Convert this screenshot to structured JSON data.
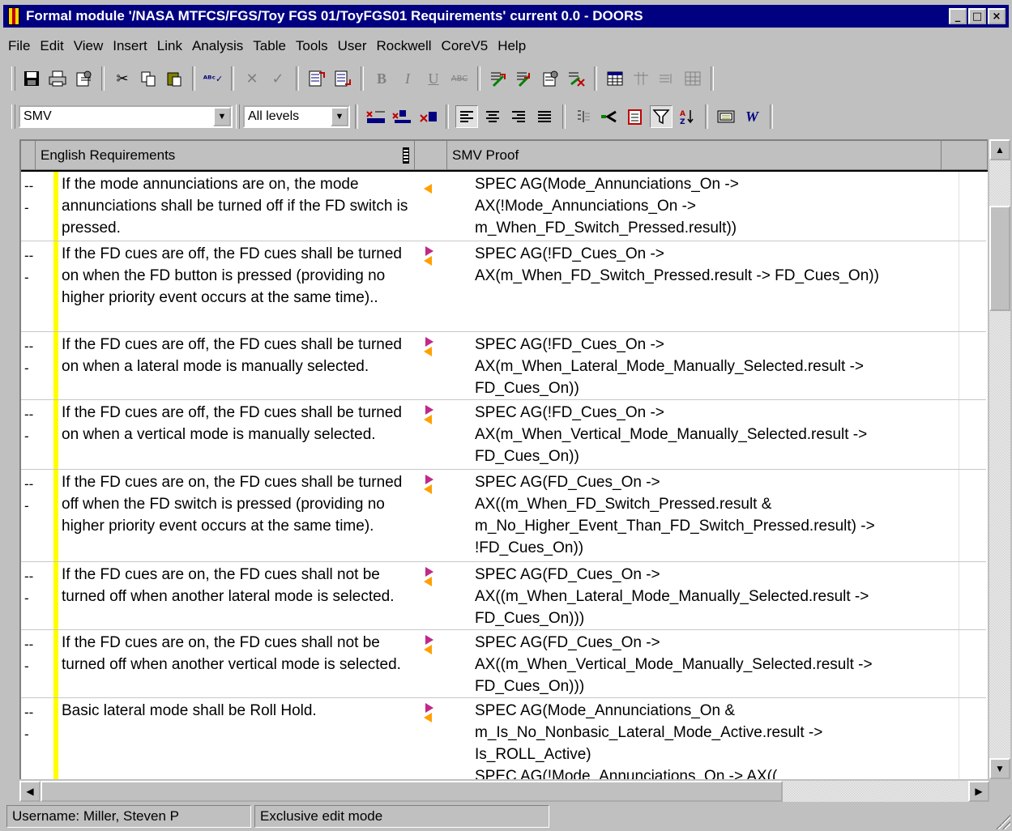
{
  "window": {
    "title": "Formal module '/NASA MTFCS/FGS/Toy FGS 01/ToyFGS01 Requirements' current 0.0 - DOORS",
    "controls": [
      "_",
      "□",
      "×"
    ]
  },
  "menu": [
    "File",
    "Edit",
    "View",
    "Insert",
    "Link",
    "Analysis",
    "Table",
    "Tools",
    "User",
    "Rockwell",
    "CoreV5",
    "Help"
  ],
  "toolbar2": {
    "view_select": "SMV",
    "level_select": "All levels"
  },
  "columns": {
    "left": "English Requirements",
    "right": "SMV Proof"
  },
  "rows": [
    {
      "level": "--\n-",
      "requirement": "If the mode annunciations are on, the mode annunciations shall be turned off if the FD switch is pressed.",
      "proof": "SPEC AG(Mode_Annunciations_On ->\nAX(!Mode_Annunciations_On ->\nm_When_FD_Switch_Pressed.result))",
      "links": "in"
    },
    {
      "level": "--\n-",
      "requirement": "If the FD cues are off, the FD cues shall be turned on when the FD button is pressed (providing no higher priority event occurs at the same time)..",
      "proof": "SPEC AG(!FD_Cues_On ->\nAX(m_When_FD_Switch_Pressed.result -> FD_Cues_On))",
      "links": "both"
    },
    {
      "level": "--\n-",
      "requirement": "If the FD cues are off, the FD cues shall be turned on when a lateral mode is manually selected.",
      "proof": "SPEC AG(!FD_Cues_On ->\nAX(m_When_Lateral_Mode_Manually_Selected.result ->\nFD_Cues_On))",
      "links": "both"
    },
    {
      "level": "--\n-",
      "requirement": "If the FD cues are off, the FD cues shall be turned on when a vertical mode is manually selected.",
      "proof": "SPEC AG(!FD_Cues_On ->\nAX(m_When_Vertical_Mode_Manually_Selected.result ->\nFD_Cues_On))",
      "links": "both"
    },
    {
      "level": "--\n-",
      "requirement": "If the FD cues are on, the FD cues shall be turned off when the FD switch is pressed (providing no higher priority event occurs at the same time).",
      "proof": "SPEC AG(FD_Cues_On ->\nAX((m_When_FD_Switch_Pressed.result &\nm_No_Higher_Event_Than_FD_Switch_Pressed.result) ->\n!FD_Cues_On))",
      "links": "both"
    },
    {
      "level": "--\n-",
      "requirement": "If the FD cues are on, the FD cues shall not be turned off when another lateral mode is selected.",
      "proof": "SPEC AG(FD_Cues_On ->\nAX((m_When_Lateral_Mode_Manually_Selected.result ->\nFD_Cues_On)))",
      "links": "both"
    },
    {
      "level": "--\n-",
      "requirement": "If the FD cues are on, the FD cues shall not be turned off when another vertical mode is selected.",
      "proof": "SPEC AG(FD_Cues_On ->\nAX((m_When_Vertical_Mode_Manually_Selected.result ->\nFD_Cues_On)))",
      "links": "both"
    },
    {
      "level": "--\n-",
      "requirement": "Basic lateral mode shall be Roll Hold.",
      "proof": "SPEC AG(Mode_Annunciations_On &\nm_Is_No_Nonbasic_Lateral_Mode_Active.result ->\nIs_ROLL_Active)\nSPEC AG(!Mode_Annunciations_On -> AX((",
      "links": "both"
    }
  ],
  "status": {
    "user": "Username: Miller, Steven P",
    "mode": "Exclusive edit mode"
  },
  "icons": {
    "toolbar1": [
      "save-icon",
      "print-icon",
      "properties-icon",
      "cut-icon",
      "copy-icon",
      "paste-icon",
      "spellcheck-icon",
      "delete-icon",
      "check-icon",
      "insert-before-icon",
      "insert-after-icon",
      "bold-icon",
      "italic-icon",
      "underline-icon",
      "strikethrough-icon",
      "link-out-icon",
      "link-in-icon",
      "link-properties-icon",
      "link-delete-icon",
      "table-icon",
      "insert-column-icon",
      "insert-row-icon",
      "grid-icon"
    ],
    "toolbar2": [
      "filter-a-icon",
      "filter-b-icon",
      "filter-c-icon",
      "align-left-icon",
      "align-center-icon",
      "align-right-icon",
      "align-justify-icon",
      "outline-icon",
      "link-arrow-icon",
      "ole-icon",
      "filter-icon",
      "sort-icon",
      "dxl-icon",
      "word-export-icon"
    ]
  }
}
